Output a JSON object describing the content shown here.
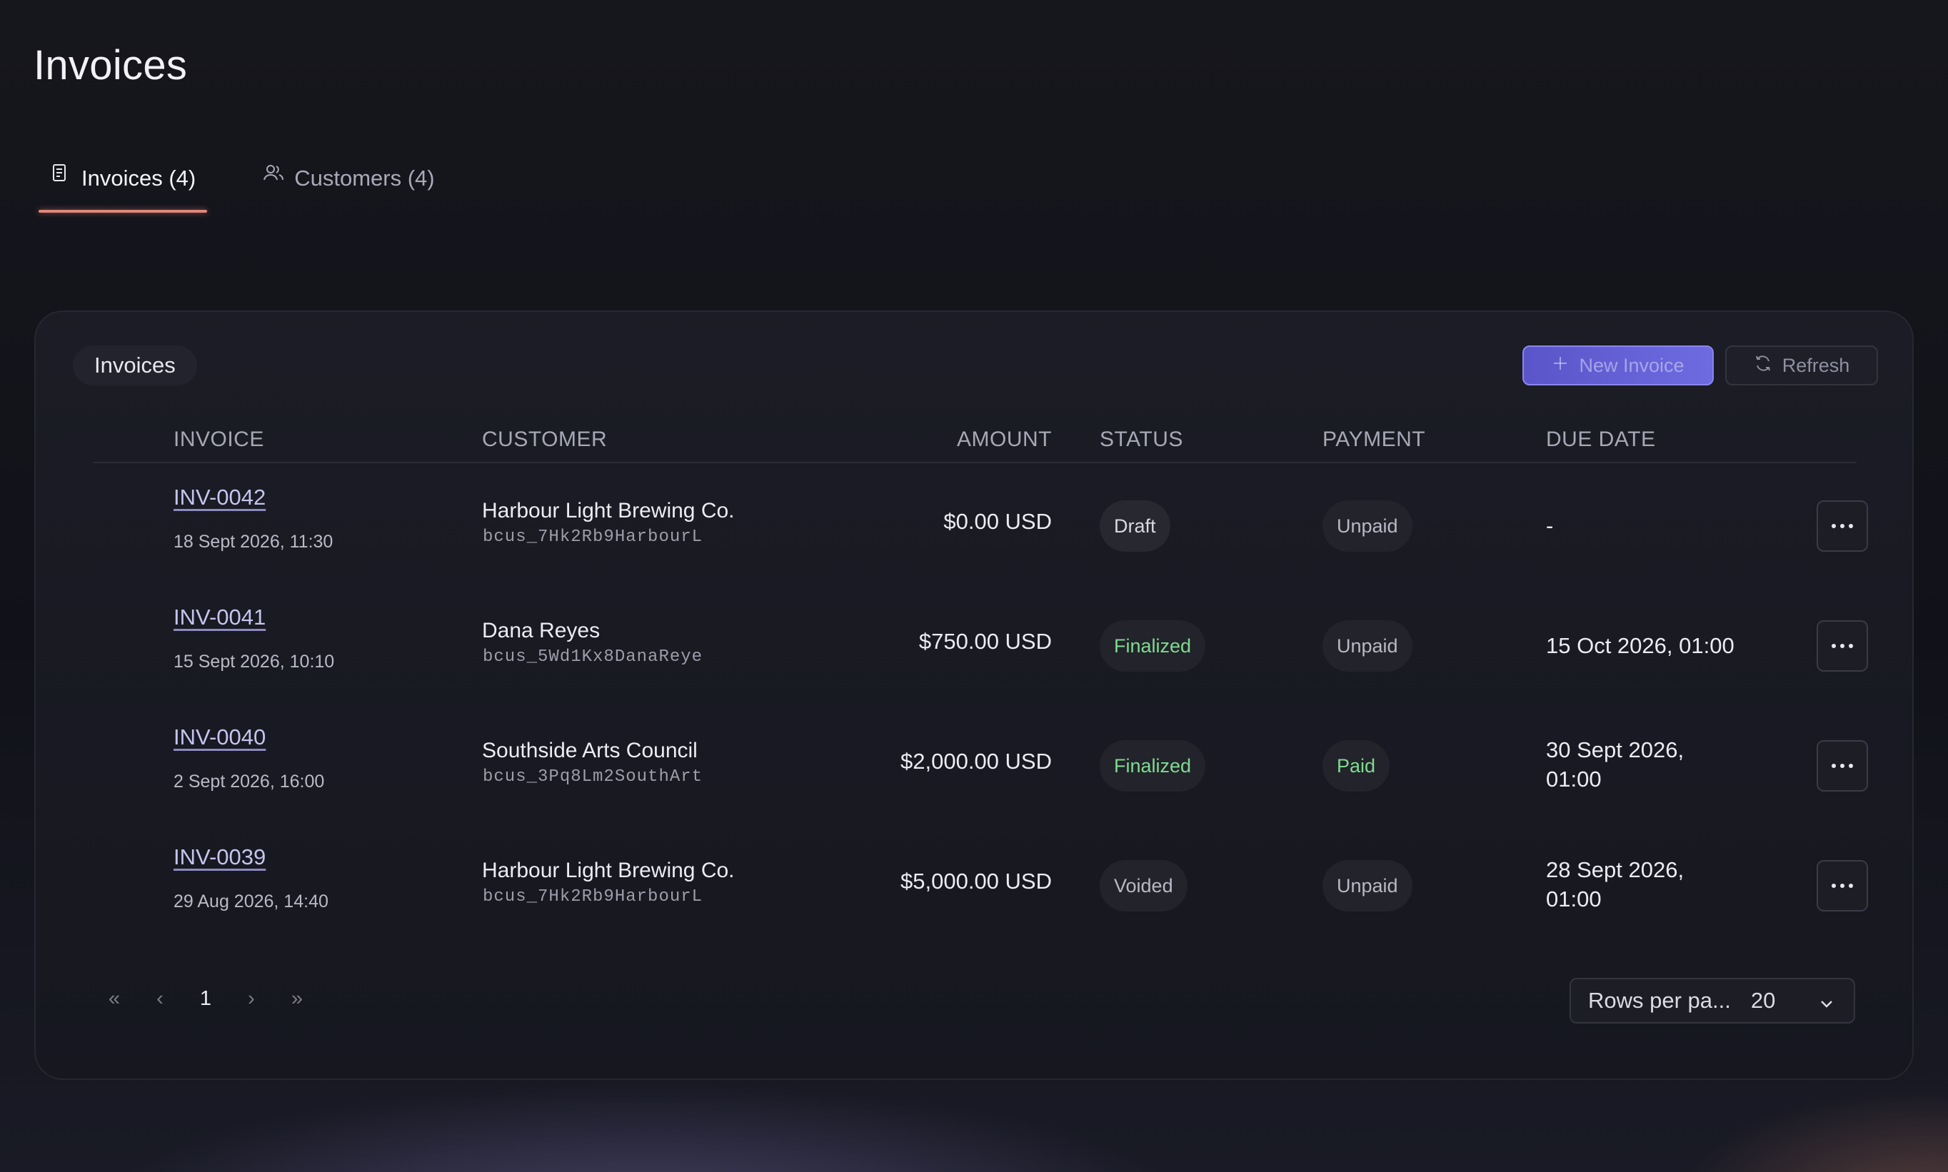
{
  "page": {
    "title": "Invoices"
  },
  "tabs": [
    {
      "label": "Invoices (4)",
      "icon": "receipt-icon",
      "active": true
    },
    {
      "label": "Customers (4)",
      "icon": "users-icon",
      "active": false
    }
  ],
  "card": {
    "label": "Invoices",
    "new_invoice_label": "New Invoice",
    "refresh_label": "Refresh"
  },
  "table": {
    "headers": {
      "invoice": "INVOICE",
      "customer": "CUSTOMER",
      "amount": "AMOUNT",
      "status": "STATUS",
      "payment": "PAYMENT",
      "due_date": "DUE DATE"
    },
    "rows": [
      {
        "invoice": "INV-0042",
        "created": "18 Sept 2026, 11:30",
        "customer_name": "Harbour Light Brewing Co.",
        "customer_id": "bcus_7Hk2Rb9HarbourL",
        "amount": "$0.00 USD",
        "status": "Draft",
        "payment": "Unpaid",
        "due_line1": "-",
        "due_line2": ""
      },
      {
        "invoice": "INV-0041",
        "created": "15 Sept 2026, 10:10",
        "customer_name": "Dana Reyes",
        "customer_id": "bcus_5Wd1Kx8DanaReye",
        "amount": "$750.00 USD",
        "status": "Finalized",
        "payment": "Unpaid",
        "due_line1": "15 Oct 2026, 01:00",
        "due_line2": ""
      },
      {
        "invoice": "INV-0040",
        "created": "2 Sept 2026, 16:00",
        "customer_name": "Southside Arts Council",
        "customer_id": "bcus_3Pq8Lm2SouthArt",
        "amount": "$2,000.00 USD",
        "status": "Finalized",
        "payment": "Paid",
        "due_line1": "30 Sept 2026,",
        "due_line2": "01:00"
      },
      {
        "invoice": "INV-0039",
        "created": "29 Aug 2026, 14:40",
        "customer_name": "Harbour Light Brewing Co.",
        "customer_id": "bcus_7Hk2Rb9HarbourL",
        "amount": "$5,000.00 USD",
        "status": "Voided",
        "payment": "Unpaid",
        "due_line1": "28 Sept 2026,",
        "due_line2": "01:00"
      }
    ]
  },
  "pagination": {
    "first": "«",
    "prev": "‹",
    "current_page": "1",
    "next": "›",
    "last": "»",
    "rows_per_page_label": "Rows per pa...",
    "rows_per_page_value": "20"
  },
  "colors": {
    "accent_tab": "#e0877a",
    "primary_button": "#6e6ae0",
    "status_green": "#7fdb8e"
  }
}
